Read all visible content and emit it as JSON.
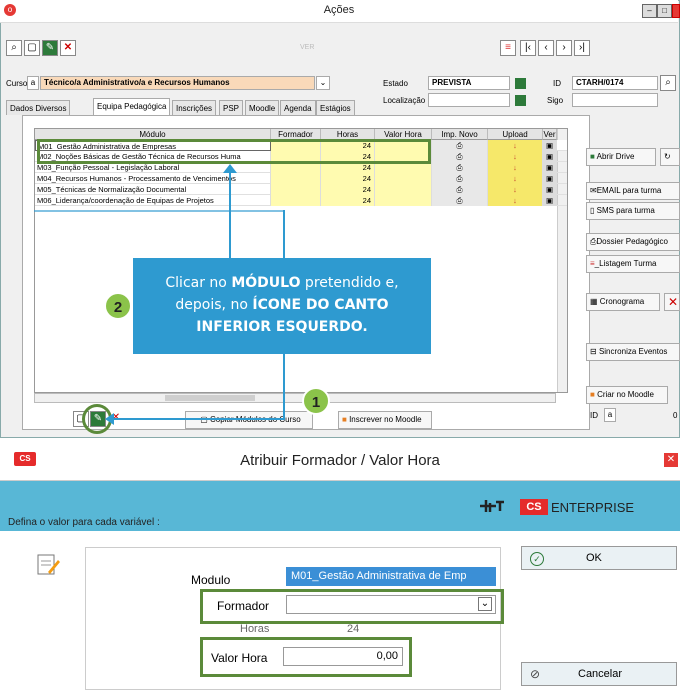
{
  "main_window": {
    "title": "Ações",
    "toolbar_ver": "VER"
  },
  "fields": {
    "curso_label": "Curso",
    "curso_value": "Técnico/a Administrativo/a e Recursos Humanos",
    "estado_label": "Estado",
    "estado_value": "PREVISTA",
    "id_label": "ID",
    "id_value": "CTARH/0174",
    "localizacao_label": "Localização",
    "sigo_label": "Sigo"
  },
  "tabs": [
    "Dados Diversos",
    "Equipa Pedagógica",
    "Inscrições",
    "PSP",
    "Moodle",
    "Agenda",
    "Estágios"
  ],
  "table": {
    "headers": [
      "Módulo",
      "Formador",
      "Horas",
      "Valor Hora",
      "Imp. Novo",
      "Upload",
      "Ver"
    ],
    "rows": [
      {
        "modulo": "M01_Gestão Administrativa de Empresas",
        "horas": "24"
      },
      {
        "modulo": "M02_Noções Básicas de Gestão Técnica de Recursos Huma",
        "horas": "24"
      },
      {
        "modulo": "M03_Função Pessoal - Legislação Laboral",
        "horas": "24"
      },
      {
        "modulo": "M04_Recursos Humanos - Processamento de Vencimentos",
        "horas": "24"
      },
      {
        "modulo": "M05_Técnicas de Normalização Documental",
        "horas": "24"
      },
      {
        "modulo": "M06_Liderança/coordenação de Equipas de Projetos",
        "horas": "24"
      }
    ]
  },
  "side_buttons": {
    "abrir_drive": "Abrir Drive",
    "email_turma": "EMAIL para turma",
    "sms_turma": "SMS para turma",
    "dossier": "Dossier Pedagógico",
    "listagem": "_Listagem Turma",
    "cronograma": "Cronograma",
    "sincroniza": "Sincroniza Eventos",
    "criar_moodle": "Criar no Moodle",
    "id_label": "ID",
    "id_value": "0"
  },
  "bottom_buttons": {
    "copiar": "Copiar Módulos do Curso",
    "inscrever": "Inscrever no Moodle"
  },
  "callout": {
    "line1_a": "Clicar no ",
    "line1_b": "MÓDULO",
    "line1_c": " pretendido e,",
    "line2_a": "depois, no ",
    "line2_b": "ÍCONE DO CANTO",
    "line3": "INFERIOR ESQUERDO."
  },
  "steps": {
    "one": "1",
    "two": "2"
  },
  "dialog": {
    "title": "Atribuir Formador / Valor Hora",
    "brand": "ENTERPRISE",
    "brand_badge": "CS",
    "instruction": "Defina o valor para cada variável :",
    "modulo_label": "Modulo",
    "modulo_value": "M01_Gestão Administrativa de Emp",
    "formador_label": "Formador",
    "formador_value": "",
    "horas_label": "Horas",
    "horas_value": "24",
    "valor_label": "Valor Hora",
    "valor_value": "0,00",
    "ok": "OK",
    "cancel": "Cancelar"
  },
  "colors": {
    "accent": "#2e9ad0",
    "highlight": "#5b8a3a",
    "badge": "#8bc34a",
    "brand_red": "#e52b2b"
  }
}
